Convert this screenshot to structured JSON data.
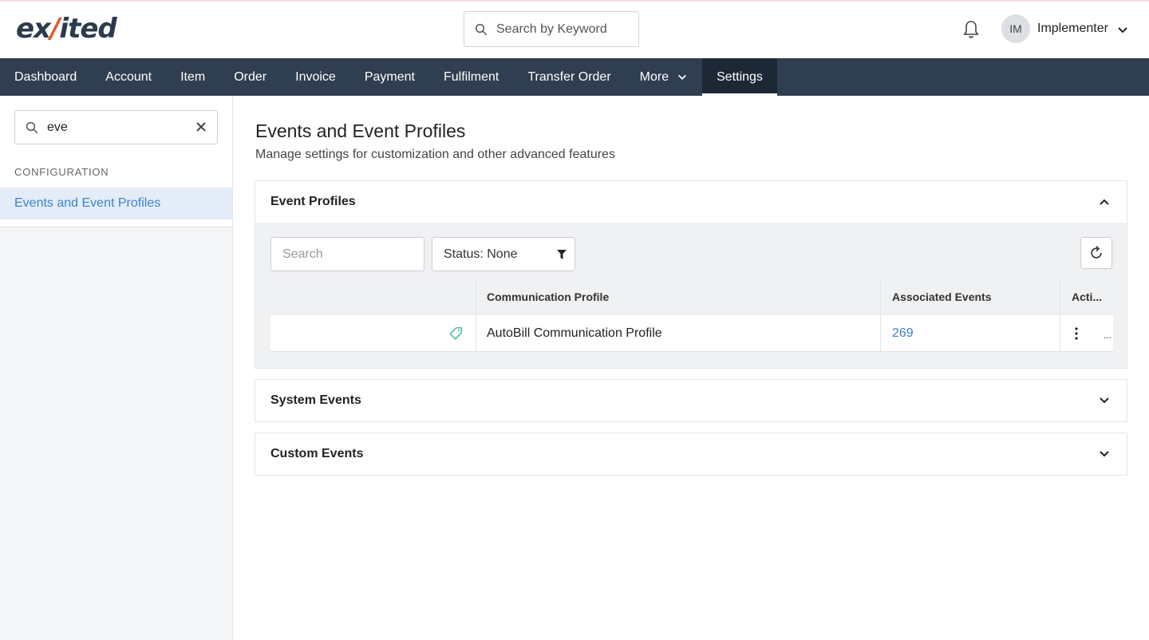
{
  "brand": {
    "logo_left": "ex",
    "logo_slash": "/",
    "logo_right": "ited",
    "accent": "#e8572a",
    "navy": "#2f3e50"
  },
  "header": {
    "search_placeholder": "Search by Keyword",
    "avatar_initials": "IM",
    "user_name": "Implementer"
  },
  "nav": {
    "items": [
      "Dashboard",
      "Account",
      "Item",
      "Order",
      "Invoice",
      "Payment",
      "Fulfilment",
      "Transfer Order"
    ],
    "more_label": "More",
    "settings_label": "Settings"
  },
  "sidebar": {
    "search_value": "eve",
    "section_label": "CONFIGURATION",
    "active_item": "Events and Event Profiles"
  },
  "main": {
    "title": "Events and Event Profiles",
    "subtitle": "Manage settings for customization and other advanced features",
    "panels": {
      "event_profiles": {
        "title": "Event Profiles",
        "search_placeholder": "Search",
        "status_filter": "Status: None",
        "columns": [
          "Communication Profile",
          "Associated Events",
          "Acti..."
        ],
        "rows": [
          {
            "profile": "AutoBill Communication Profile",
            "associated_events": "269",
            "actions_more": "..."
          }
        ]
      },
      "system_events": {
        "title": "System Events"
      },
      "custom_events": {
        "title": "Custom Events"
      }
    }
  }
}
